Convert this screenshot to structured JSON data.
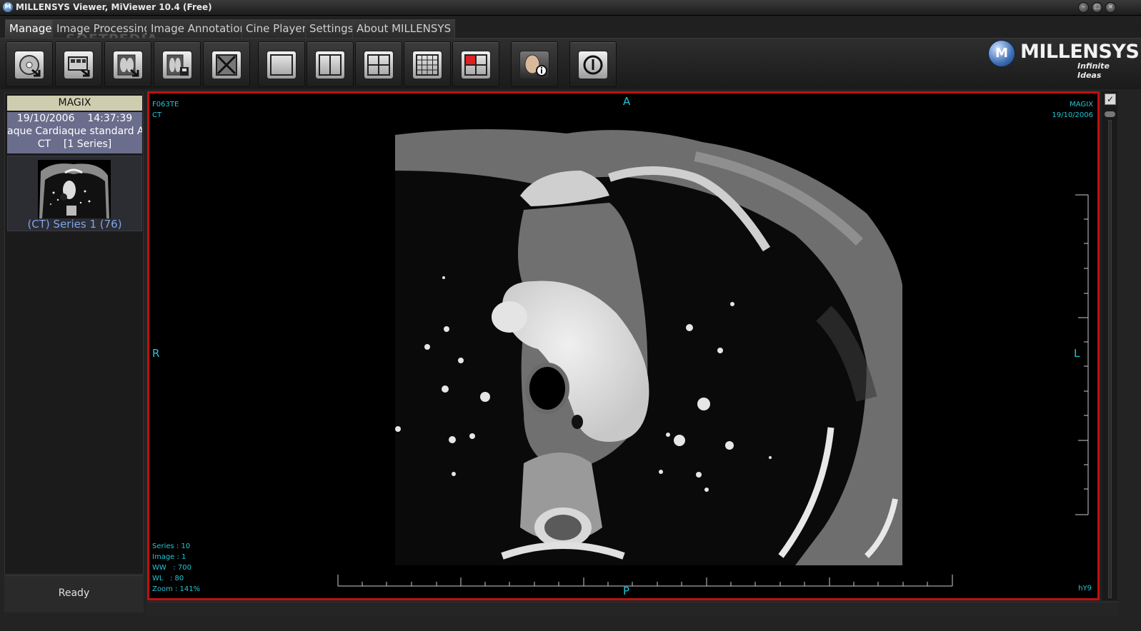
{
  "window": {
    "title": "MILLENSYS Viewer, MiViewer 10.4 (Free)",
    "controls": [
      "minimize",
      "restore",
      "close"
    ]
  },
  "watermark": "SOFTPEDIA",
  "tabs": [
    {
      "label": "Manage",
      "active": true
    },
    {
      "label": "Image Processing",
      "active": false
    },
    {
      "label": "Image Annotation",
      "active": false
    },
    {
      "label": "Cine Player",
      "active": false
    },
    {
      "label": "Settings",
      "active": false
    },
    {
      "label": "About MILLENSYS",
      "active": false
    }
  ],
  "toolbar": {
    "buttons": [
      {
        "icon": "open-cd-icon"
      },
      {
        "icon": "open-folder-icon"
      },
      {
        "icon": "load-xray-icon"
      },
      {
        "icon": "save-image-icon"
      },
      {
        "icon": "close-image-icon"
      },
      {
        "icon": "layout-1x1-icon"
      },
      {
        "icon": "layout-1x2-icon"
      },
      {
        "icon": "layout-2x2-icon"
      },
      {
        "icon": "layout-3x3-icon"
      },
      {
        "icon": "layout-custom-icon"
      },
      {
        "icon": "patient-info-icon"
      },
      {
        "icon": "power-icon"
      }
    ]
  },
  "logo": {
    "mark": "M",
    "name": "MILLENSYS",
    "tagline": "Infinite Ideas"
  },
  "patient_panel": {
    "patient_name": "MAGIX",
    "study_date": "19/10/2006",
    "study_time": "14:37:39",
    "study_desc": "aque Cardiaque standard  Ad",
    "modality": "CT",
    "series_count": "[1 Series]",
    "series_label": "(CT) Series 1 (76)"
  },
  "status": {
    "text": "Ready"
  },
  "viewport": {
    "top_left": [
      "F063TE",
      "CT"
    ],
    "top_right": [
      "MAGIX",
      "19/10/2006"
    ],
    "orientation": {
      "top": "A",
      "bottom": "P",
      "left": "R",
      "right": "L"
    },
    "bottom_left": [
      "Series : 10",
      "Image : 1",
      "WW   : 700",
      "WL   : 80",
      "Zoom : 141%"
    ],
    "bottom_right": "hY9",
    "border_color": "#c01010",
    "overlay_color": "#21c7d6"
  }
}
